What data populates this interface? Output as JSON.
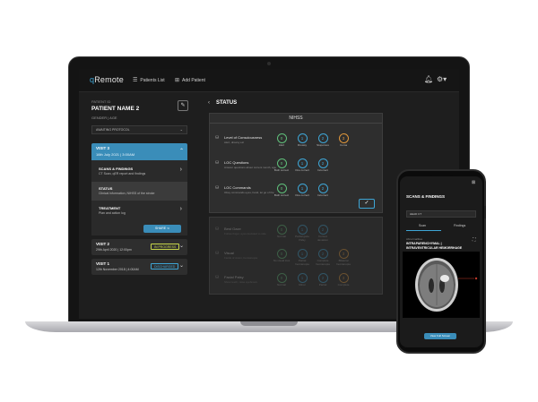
{
  "app": {
    "logo_prefix": "q",
    "logo_name": "Remote",
    "nav_patients": "Patients List",
    "nav_add": "Add Patient"
  },
  "patient": {
    "id_label": "PATIENT ID",
    "name": "PATIENT NAME 2",
    "gender_age": "GENDER | AGE",
    "protocol": "AWAITING PROTOCOL"
  },
  "visits": [
    {
      "title": "VISIT 3",
      "date": "16th July 2021 | 3:00AM",
      "menu": [
        {
          "title": "SCANS & FINDINGS",
          "sub": "CT Scan, qER report and findings"
        },
        {
          "title": "STATUS",
          "sub": "Clinical information, NIHSS of the stroke"
        },
        {
          "title": "TREATMENT",
          "sub": "Plan and action log"
        }
      ],
      "share_label": "SHARE"
    },
    {
      "title": "VISIT 2",
      "date": "29th April 2020 | 12:00pm",
      "badge": "IN PROGRESS",
      "badge_color": "#c9d84a"
    },
    {
      "title": "VISIT 1",
      "date": "12th November 2018 | 4:00AM",
      "badge": "DISCHARGED",
      "badge_color": "#3ea6d6"
    }
  ],
  "status": {
    "title": "STATUS",
    "panel_title": "NIHSS",
    "questions": [
      {
        "id": "1a",
        "title": "Level of Consciousness",
        "sub": "Alert, drowsy etc",
        "options": [
          {
            "score": "0",
            "label": "Alert"
          },
          {
            "score": "1",
            "label": "Drowsy"
          },
          {
            "score": "2",
            "label": "Stuporous"
          },
          {
            "score": "3",
            "label": "Coma"
          }
        ]
      },
      {
        "id": "1b",
        "title": "LOC Questions",
        "sub": "Answer questions about current month, age",
        "options": [
          {
            "score": "0",
            "label": "Both correct"
          },
          {
            "score": "1",
            "label": "One correct"
          },
          {
            "score": "2",
            "label": "Incorrect"
          }
        ]
      },
      {
        "id": "1c",
        "title": "LOC Commands",
        "sub": "Obey commands eyes, hand, let go of the",
        "options": [
          {
            "score": "0",
            "label": "Both correct"
          },
          {
            "score": "1",
            "label": "One correct"
          },
          {
            "score": "2",
            "label": "Incorrect"
          }
        ]
      },
      {
        "id": "2",
        "title": "Best Gaze",
        "sub": "Follow finger, eyes deviated to side",
        "options": [
          {
            "score": "0",
            "label": "Normal"
          },
          {
            "score": "1",
            "label": "Partial gaze Palsy"
          },
          {
            "score": "2",
            "label": "Forced deviation"
          }
        ]
      },
      {
        "id": "3",
        "title": "Visual",
        "sub": "Fields of vision, hemianopia",
        "options": [
          {
            "score": "0",
            "label": "No visual loss"
          },
          {
            "score": "1",
            "label": "Partial hemianopia"
          },
          {
            "score": "2",
            "label": "Complete hemianopia"
          },
          {
            "score": "3",
            "label": "Bilateral hemianopia"
          }
        ]
      },
      {
        "id": "4",
        "title": "Facial Palsy",
        "sub": "Show teeth, raise eyebrows",
        "options": [
          {
            "score": "0",
            "label": "Normal"
          },
          {
            "score": "1",
            "label": "Minor"
          },
          {
            "score": "2",
            "label": "Partial"
          },
          {
            "score": "3",
            "label": "Complete"
          }
        ]
      }
    ]
  },
  "phone": {
    "title": "SCANS & FINDINGS",
    "select": "HEAD CT",
    "tabs": [
      "Scan",
      "Findings"
    ],
    "label": "Abnormalities",
    "finding": "INTRAPARENCHYMAL | INTRAVENTRICULAR HEMORRHAGE",
    "view_button": "View Full Screen"
  },
  "colors": {
    "accent": "#3ea6d6",
    "option_green": "#5fbf7a",
    "option_orange": "#e0973b"
  }
}
